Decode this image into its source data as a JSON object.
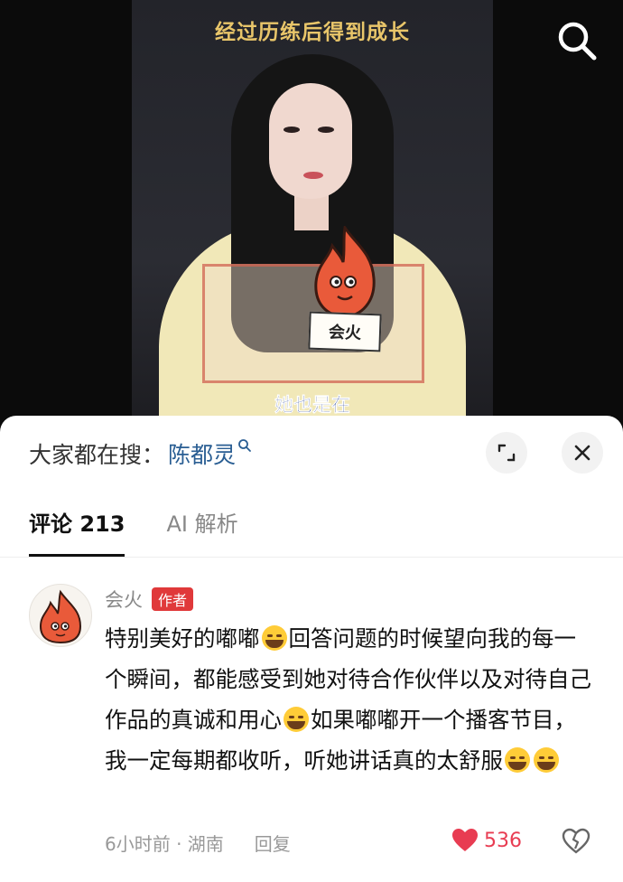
{
  "video": {
    "caption_top": "经过历练后得到成长",
    "caption_bottom": "她也是在",
    "sign_text": "会火"
  },
  "search_suggest": {
    "prefix": "大家都在搜：",
    "term": "陈都灵"
  },
  "tabs": [
    {
      "label": "评论 213"
    },
    {
      "label": "AI 解析"
    }
  ],
  "comment": {
    "username": "会火",
    "badge": "作者",
    "text_parts": [
      "特别美好的嘟嘟",
      "回答问题的时候望向我的每一个瞬间，都能感受到她对待合作伙伴以及对待自己作品的真诚和用心",
      "如果嘟嘟开一个播客节目，我一定每期都收听，听她讲话真的太舒服"
    ],
    "time": "6小时前 · 湖南",
    "reply_label": "回复",
    "likes": "536"
  },
  "colors": {
    "link": "#2a5e93",
    "badge": "#e0393a",
    "like": "#e83c52"
  }
}
